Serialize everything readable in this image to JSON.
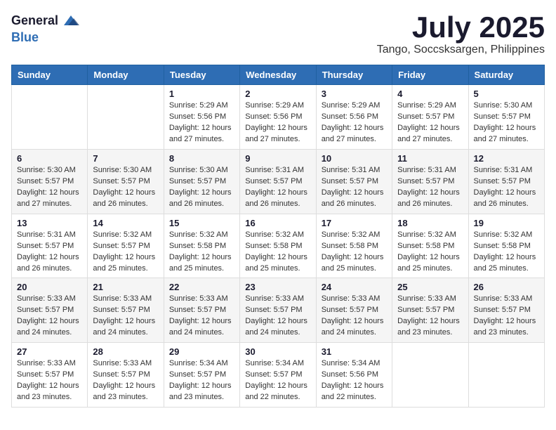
{
  "logo": {
    "general": "General",
    "blue": "Blue"
  },
  "header": {
    "title": "July 2025",
    "subtitle": "Tango, Soccsksargen, Philippines"
  },
  "calendar": {
    "weekdays": [
      "Sunday",
      "Monday",
      "Tuesday",
      "Wednesday",
      "Thursday",
      "Friday",
      "Saturday"
    ],
    "weeks": [
      [
        {
          "day": "",
          "info": ""
        },
        {
          "day": "",
          "info": ""
        },
        {
          "day": "1",
          "sunrise": "Sunrise: 5:29 AM",
          "sunset": "Sunset: 5:56 PM",
          "daylight": "Daylight: 12 hours and 27 minutes."
        },
        {
          "day": "2",
          "sunrise": "Sunrise: 5:29 AM",
          "sunset": "Sunset: 5:56 PM",
          "daylight": "Daylight: 12 hours and 27 minutes."
        },
        {
          "day": "3",
          "sunrise": "Sunrise: 5:29 AM",
          "sunset": "Sunset: 5:56 PM",
          "daylight": "Daylight: 12 hours and 27 minutes."
        },
        {
          "day": "4",
          "sunrise": "Sunrise: 5:29 AM",
          "sunset": "Sunset: 5:57 PM",
          "daylight": "Daylight: 12 hours and 27 minutes."
        },
        {
          "day": "5",
          "sunrise": "Sunrise: 5:30 AM",
          "sunset": "Sunset: 5:57 PM",
          "daylight": "Daylight: 12 hours and 27 minutes."
        }
      ],
      [
        {
          "day": "6",
          "sunrise": "Sunrise: 5:30 AM",
          "sunset": "Sunset: 5:57 PM",
          "daylight": "Daylight: 12 hours and 27 minutes."
        },
        {
          "day": "7",
          "sunrise": "Sunrise: 5:30 AM",
          "sunset": "Sunset: 5:57 PM",
          "daylight": "Daylight: 12 hours and 26 minutes."
        },
        {
          "day": "8",
          "sunrise": "Sunrise: 5:30 AM",
          "sunset": "Sunset: 5:57 PM",
          "daylight": "Daylight: 12 hours and 26 minutes."
        },
        {
          "day": "9",
          "sunrise": "Sunrise: 5:31 AM",
          "sunset": "Sunset: 5:57 PM",
          "daylight": "Daylight: 12 hours and 26 minutes."
        },
        {
          "day": "10",
          "sunrise": "Sunrise: 5:31 AM",
          "sunset": "Sunset: 5:57 PM",
          "daylight": "Daylight: 12 hours and 26 minutes."
        },
        {
          "day": "11",
          "sunrise": "Sunrise: 5:31 AM",
          "sunset": "Sunset: 5:57 PM",
          "daylight": "Daylight: 12 hours and 26 minutes."
        },
        {
          "day": "12",
          "sunrise": "Sunrise: 5:31 AM",
          "sunset": "Sunset: 5:57 PM",
          "daylight": "Daylight: 12 hours and 26 minutes."
        }
      ],
      [
        {
          "day": "13",
          "sunrise": "Sunrise: 5:31 AM",
          "sunset": "Sunset: 5:57 PM",
          "daylight": "Daylight: 12 hours and 26 minutes."
        },
        {
          "day": "14",
          "sunrise": "Sunrise: 5:32 AM",
          "sunset": "Sunset: 5:57 PM",
          "daylight": "Daylight: 12 hours and 25 minutes."
        },
        {
          "day": "15",
          "sunrise": "Sunrise: 5:32 AM",
          "sunset": "Sunset: 5:58 PM",
          "daylight": "Daylight: 12 hours and 25 minutes."
        },
        {
          "day": "16",
          "sunrise": "Sunrise: 5:32 AM",
          "sunset": "Sunset: 5:58 PM",
          "daylight": "Daylight: 12 hours and 25 minutes."
        },
        {
          "day": "17",
          "sunrise": "Sunrise: 5:32 AM",
          "sunset": "Sunset: 5:58 PM",
          "daylight": "Daylight: 12 hours and 25 minutes."
        },
        {
          "day": "18",
          "sunrise": "Sunrise: 5:32 AM",
          "sunset": "Sunset: 5:58 PM",
          "daylight": "Daylight: 12 hours and 25 minutes."
        },
        {
          "day": "19",
          "sunrise": "Sunrise: 5:32 AM",
          "sunset": "Sunset: 5:58 PM",
          "daylight": "Daylight: 12 hours and 25 minutes."
        }
      ],
      [
        {
          "day": "20",
          "sunrise": "Sunrise: 5:33 AM",
          "sunset": "Sunset: 5:57 PM",
          "daylight": "Daylight: 12 hours and 24 minutes."
        },
        {
          "day": "21",
          "sunrise": "Sunrise: 5:33 AM",
          "sunset": "Sunset: 5:57 PM",
          "daylight": "Daylight: 12 hours and 24 minutes."
        },
        {
          "day": "22",
          "sunrise": "Sunrise: 5:33 AM",
          "sunset": "Sunset: 5:57 PM",
          "daylight": "Daylight: 12 hours and 24 minutes."
        },
        {
          "day": "23",
          "sunrise": "Sunrise: 5:33 AM",
          "sunset": "Sunset: 5:57 PM",
          "daylight": "Daylight: 12 hours and 24 minutes."
        },
        {
          "day": "24",
          "sunrise": "Sunrise: 5:33 AM",
          "sunset": "Sunset: 5:57 PM",
          "daylight": "Daylight: 12 hours and 24 minutes."
        },
        {
          "day": "25",
          "sunrise": "Sunrise: 5:33 AM",
          "sunset": "Sunset: 5:57 PM",
          "daylight": "Daylight: 12 hours and 23 minutes."
        },
        {
          "day": "26",
          "sunrise": "Sunrise: 5:33 AM",
          "sunset": "Sunset: 5:57 PM",
          "daylight": "Daylight: 12 hours and 23 minutes."
        }
      ],
      [
        {
          "day": "27",
          "sunrise": "Sunrise: 5:33 AM",
          "sunset": "Sunset: 5:57 PM",
          "daylight": "Daylight: 12 hours and 23 minutes."
        },
        {
          "day": "28",
          "sunrise": "Sunrise: 5:33 AM",
          "sunset": "Sunset: 5:57 PM",
          "daylight": "Daylight: 12 hours and 23 minutes."
        },
        {
          "day": "29",
          "sunrise": "Sunrise: 5:34 AM",
          "sunset": "Sunset: 5:57 PM",
          "daylight": "Daylight: 12 hours and 23 minutes."
        },
        {
          "day": "30",
          "sunrise": "Sunrise: 5:34 AM",
          "sunset": "Sunset: 5:57 PM",
          "daylight": "Daylight: 12 hours and 22 minutes."
        },
        {
          "day": "31",
          "sunrise": "Sunrise: 5:34 AM",
          "sunset": "Sunset: 5:56 PM",
          "daylight": "Daylight: 12 hours and 22 minutes."
        },
        {
          "day": "",
          "info": ""
        },
        {
          "day": "",
          "info": ""
        }
      ]
    ]
  }
}
